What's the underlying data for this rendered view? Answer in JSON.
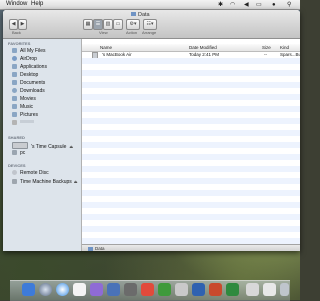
{
  "menubar": {
    "items": [
      "Window",
      "Help"
    ]
  },
  "window": {
    "title": "Data",
    "toolbar": {
      "back_label": "Back",
      "view_label": "View",
      "action_label": "Action",
      "arrange_label": "Arrange"
    },
    "sidebar": {
      "favorites_heading": "FAVORITES",
      "favorites": [
        "All My Files",
        "AirDrop",
        "Applications",
        "Desktop",
        "Documents",
        "Downloads",
        "Movies",
        "Music",
        "Pictures"
      ],
      "shared_heading": "SHARED",
      "shared": [
        "'s Time Capsule",
        "pc"
      ],
      "devices_heading": "DEVICES",
      "devices": [
        "Remote Disc",
        "Time Machine Backups"
      ]
    },
    "columns": {
      "name": "Name",
      "date": "Date Modified",
      "size": "Size",
      "kind": "Kind"
    },
    "rows": [
      {
        "name": "'s MacBook Air",
        "date": "Today 2:41 PM",
        "size": "--",
        "kind": "Spars...Bundle"
      }
    ],
    "path": "Data"
  },
  "colors": {
    "sidebar_bg": "#dde4eb",
    "stripe": "#edf3fe"
  }
}
